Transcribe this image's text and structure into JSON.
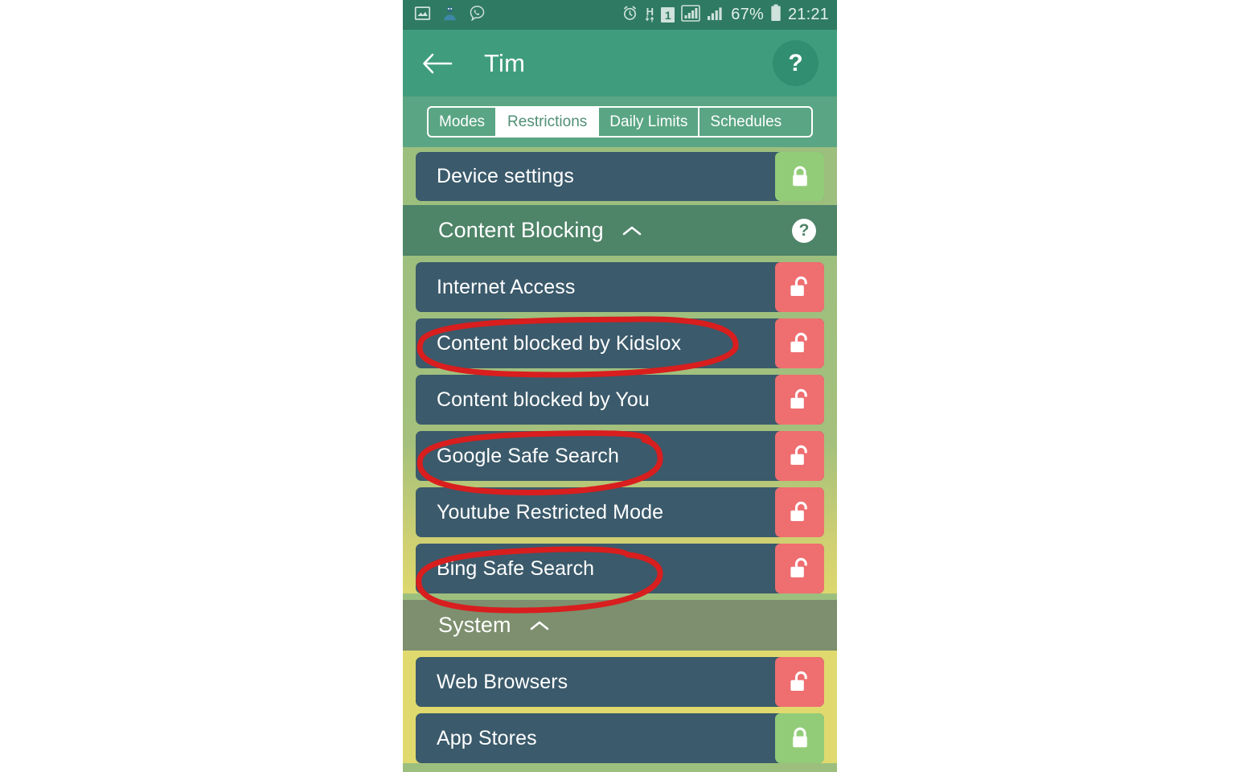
{
  "statusbar": {
    "left_icons": [
      "screenshot-icon",
      "avatar-icon",
      "viber-icon"
    ],
    "right_icons": [
      "alarm-icon",
      "hspa-data-icon",
      "sim1-icon",
      "signal1-icon",
      "signal2-icon"
    ],
    "sim_label": "1",
    "network_type": "H",
    "battery_percent": "67%",
    "time": "21:21"
  },
  "appbar": {
    "back_icon": "back-arrow-icon",
    "title": "Tim",
    "help_label": "?"
  },
  "tabs": [
    {
      "label": "Modes",
      "active": false
    },
    {
      "label": "Restrictions",
      "active": true
    },
    {
      "label": "Daily Limits",
      "active": false
    },
    {
      "label": "Schedules",
      "active": false
    }
  ],
  "top_row": {
    "label": "Device settings",
    "lock_state": "locked"
  },
  "sections": [
    {
      "id": "content-blocking",
      "title": "Content Blocking",
      "collapsed": false,
      "chevron": "chevron-up-icon",
      "has_help": true,
      "help_label": "?",
      "rows": [
        {
          "label": "Internet Access",
          "lock_state": "unlocked",
          "annotated": false
        },
        {
          "label": "Content blocked by Kidslox",
          "lock_state": "unlocked",
          "annotated": true
        },
        {
          "label": "Content blocked by You",
          "lock_state": "unlocked",
          "annotated": false
        },
        {
          "label": "Google Safe Search",
          "lock_state": "unlocked",
          "annotated": true
        },
        {
          "label": "Youtube Restricted Mode",
          "lock_state": "unlocked",
          "annotated": false
        },
        {
          "label": "Bing Safe Search",
          "lock_state": "unlocked",
          "annotated": true
        }
      ]
    },
    {
      "id": "system",
      "title": "System",
      "collapsed": false,
      "chevron": "chevron-up-icon",
      "has_help": false,
      "help_label": "",
      "rows": [
        {
          "label": "Web Browsers",
          "lock_state": "unlocked",
          "annotated": false
        },
        {
          "label": "App Stores",
          "lock_state": "locked",
          "annotated": false
        }
      ]
    }
  ],
  "colors": {
    "status_bar": "#2f7a62",
    "app_bar": "#3f9d7e",
    "tab_bar": "#5aa583",
    "section_content_blocking": "#4e8468",
    "section_system": "#7d8f6e",
    "band_green": "#9dbf7e",
    "band_yellow": "#e0da6e",
    "row": "#3b5a6b",
    "lock_locked": "#93cc79",
    "lock_unlocked": "#ef6e70",
    "annotation": "#d81e1e"
  }
}
